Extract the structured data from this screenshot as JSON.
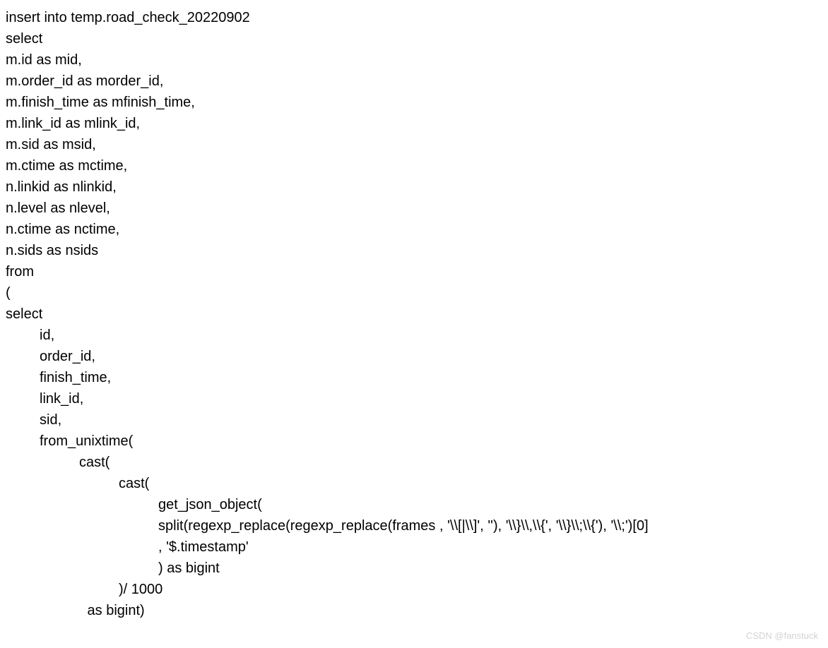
{
  "code": {
    "line1": "insert into temp.road_check_20220902",
    "line2": "select",
    "line3": "m.id as mid,",
    "line4": "m.order_id as morder_id,",
    "line5": "m.finish_time as mfinish_time,",
    "line6": "m.link_id as mlink_id,",
    "line7": "m.sid as msid,",
    "line8": "m.ctime as mctime,",
    "line9": "n.linkid as nlinkid,",
    "line10": "n.level as nlevel,",
    "line11": "n.ctime as nctime,",
    "line12": "n.sids as nsids",
    "line13": "from",
    "line14": "(",
    "line15": "select",
    "line16": "id,",
    "line17": "order_id,",
    "line18": "finish_time,",
    "line19": "link_id,",
    "line20": "sid,",
    "line21": "from_unixtime(",
    "line22": "cast(",
    "line23": "cast(",
    "line24": "get_json_object(",
    "line25": "split(regexp_replace(regexp_replace(frames , '\\\\[|\\\\]', ''), '\\\\}\\\\,\\\\{', '\\\\}\\\\;\\\\{'), '\\\\;')[0]",
    "line26": ", '$.timestamp'",
    "line27": ") as bigint",
    "line28": ")/ 1000",
    "line29": " as bigint)"
  },
  "watermark": "CSDN @fanstuck"
}
